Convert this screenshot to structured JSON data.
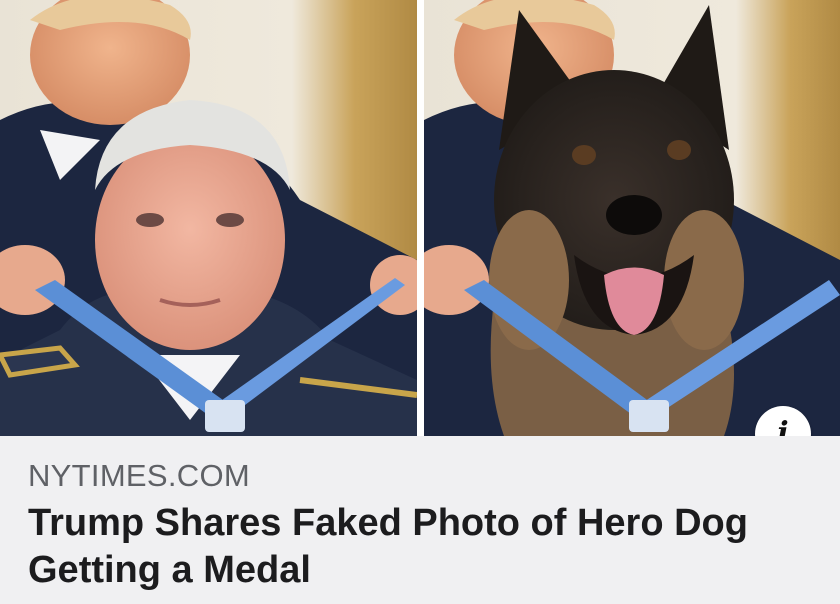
{
  "link_preview": {
    "source": "NYTIMES.COM",
    "headline": "Trump Shares Faked Photo of Hero Dog Getting a Medal",
    "info_icon": "info-icon",
    "info_glyph": "i"
  },
  "images": {
    "left_photo": "Medal ceremony photo: man receiving a blue ribbon medal",
    "right_photo": "Edited photo: dog receiving a blue ribbon medal"
  },
  "colors": {
    "ribbon": "#5b8fd6",
    "background": "#f0f0f2",
    "source_text": "#5f6166",
    "headline_text": "#1c1c1e"
  }
}
